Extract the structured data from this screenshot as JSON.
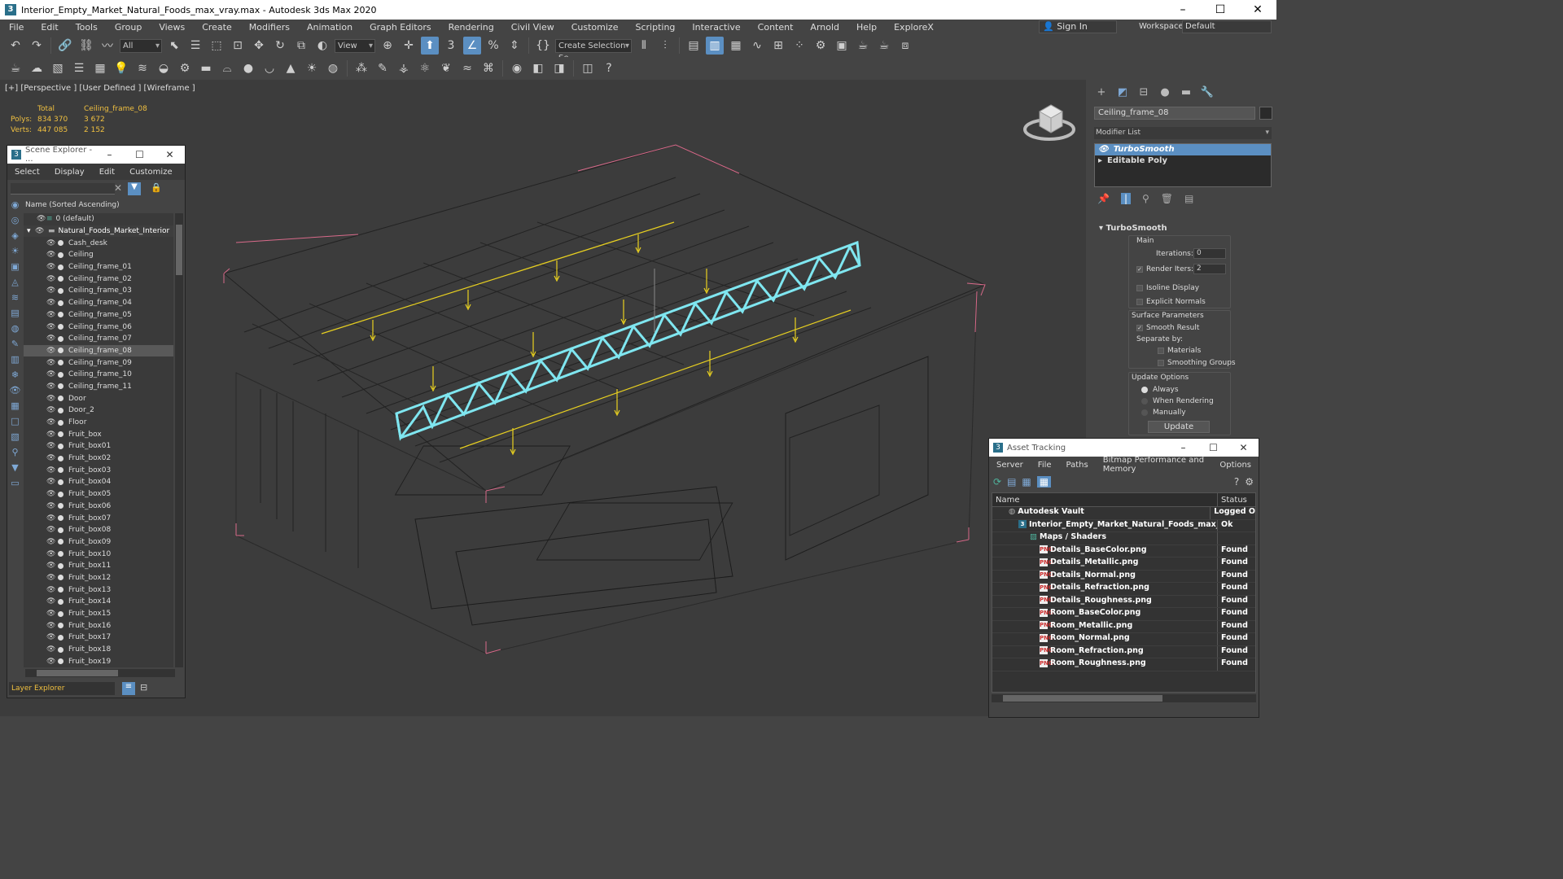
{
  "window": {
    "title": "Interior_Empty_Market_Natural_Foods_max_vray.max - Autodesk 3ds Max 2020"
  },
  "menu": [
    "File",
    "Edit",
    "Tools",
    "Group",
    "Views",
    "Create",
    "Modifiers",
    "Animation",
    "Graph Editors",
    "Rendering",
    "Civil View",
    "Customize",
    "Scripting",
    "Interactive",
    "Content",
    "Arnold",
    "Help",
    "ExploreX"
  ],
  "signin": "Sign In",
  "workspaces": {
    "label": "Workspaces:",
    "value": "Default"
  },
  "toolbar": {
    "filter": "All",
    "refcoord": "View",
    "selset": "Create Selection Se"
  },
  "viewport": {
    "label": "[+] [Perspective ] [User Defined ] [Wireframe ]",
    "stats": {
      "total_label": "Total",
      "object_label": "Ceiling_frame_08",
      "polys_label": "Polys:",
      "polys_total": "834 370",
      "polys_obj": "3 672",
      "verts_label": "Verts:",
      "verts_total": "447 085",
      "verts_obj": "2 152"
    }
  },
  "command_panel": {
    "object_name": "Ceiling_frame_08",
    "modifier_list": "Modifier List",
    "stack": [
      "TurboSmooth",
      "Editable Poly"
    ],
    "rollout": "TurboSmooth",
    "main": "Main",
    "iterations_label": "Iterations:",
    "iterations": "0",
    "render_iters_label": "Render Iters:",
    "render_iters": "2",
    "isoline": "Isoline Display",
    "explicit": "Explicit Normals",
    "surface": "Surface Parameters",
    "smooth_result": "Smooth Result",
    "separate": "Separate by:",
    "materials": "Materials",
    "smoothing_groups": "Smoothing Groups",
    "update_options": "Update Options",
    "always": "Always",
    "when_rendering": "When Rendering",
    "manually": "Manually",
    "update": "Update"
  },
  "scene_explorer": {
    "title": "Scene Explorer - ...",
    "menu": [
      "Select",
      "Display",
      "Edit",
      "Customize"
    ],
    "column": "Name (Sorted Ascending)",
    "layer0": "0 (default)",
    "root": "Natural_Foods_Market_Interior",
    "items": [
      "Cash_desk",
      "Ceiling",
      "Ceiling_frame_01",
      "Ceiling_frame_02",
      "Ceiling_frame_03",
      "Ceiling_frame_04",
      "Ceiling_frame_05",
      "Ceiling_frame_06",
      "Ceiling_frame_07",
      "Ceiling_frame_08",
      "Ceiling_frame_09",
      "Ceiling_frame_10",
      "Ceiling_frame_11",
      "Door",
      "Door_2",
      "Floor",
      "Fruit_box",
      "Fruit_box01",
      "Fruit_box02",
      "Fruit_box03",
      "Fruit_box04",
      "Fruit_box05",
      "Fruit_box06",
      "Fruit_box07",
      "Fruit_box08",
      "Fruit_box09",
      "Fruit_box10",
      "Fruit_box11",
      "Fruit_box12",
      "Fruit_box13",
      "Fruit_box14",
      "Fruit_box15",
      "Fruit_box16",
      "Fruit_box17",
      "Fruit_box18",
      "Fruit_box19"
    ],
    "selected": "Ceiling_frame_08",
    "footer": "Layer Explorer"
  },
  "asset_tracking": {
    "title": "Asset Tracking",
    "menu": [
      "Server",
      "File",
      "Paths",
      "Bitmap Performance and Memory",
      "Options"
    ],
    "columns": [
      "Name",
      "Status"
    ],
    "vault": {
      "name": "Autodesk Vault",
      "status": "Logged O"
    },
    "file": {
      "name": "Interior_Empty_Market_Natural_Foods_max_vray.max",
      "status": "Ok"
    },
    "group": "Maps / Shaders",
    "maps": [
      {
        "name": "Details_BaseColor.png",
        "status": "Found"
      },
      {
        "name": "Details_Metallic.png",
        "status": "Found"
      },
      {
        "name": "Details_Normal.png",
        "status": "Found"
      },
      {
        "name": "Details_Refraction.png",
        "status": "Found"
      },
      {
        "name": "Details_Roughness.png",
        "status": "Found"
      },
      {
        "name": "Room_BaseColor.png",
        "status": "Found"
      },
      {
        "name": "Room_Metallic.png",
        "status": "Found"
      },
      {
        "name": "Room_Normal.png",
        "status": "Found"
      },
      {
        "name": "Room_Refraction.png",
        "status": "Found"
      },
      {
        "name": "Room_Roughness.png",
        "status": "Found"
      }
    ]
  },
  "colors": {
    "selection": "#5b8fc2",
    "highlight_object": "#7fe6f0",
    "light_gizmo": "#e8d020",
    "bbox": "#d86a8a"
  }
}
